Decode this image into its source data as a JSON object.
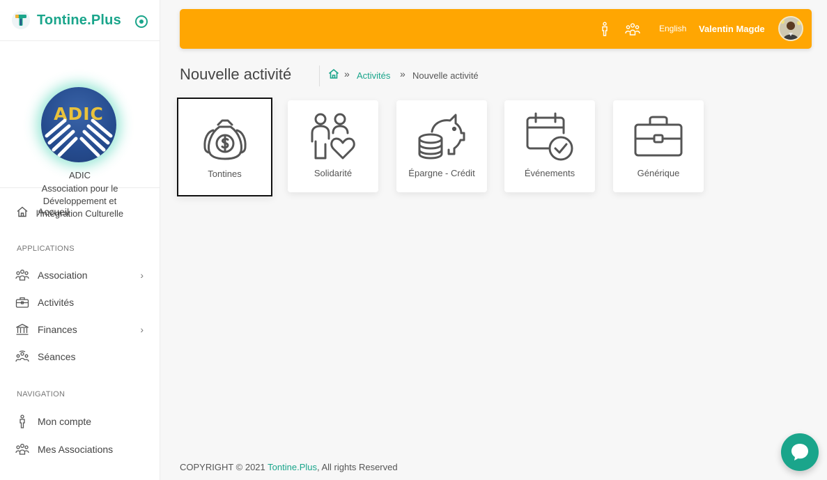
{
  "brand": {
    "name": "Tontine.Plus"
  },
  "organization": {
    "logo_text": "ADIC",
    "short_name": "ADIC",
    "full_name": "Association pour le Développement et l'Intégration Culturelle"
  },
  "sidebar": {
    "home": "Accueil",
    "section_applications": "APPLICATIONS",
    "applications": [
      {
        "label": "Association",
        "icon": "group-icon",
        "has_submenu": true
      },
      {
        "label": "Activités",
        "icon": "briefcase-icon",
        "has_submenu": false
      },
      {
        "label": "Finances",
        "icon": "bank-icon",
        "has_submenu": true
      },
      {
        "label": "Séances",
        "icon": "meeting-icon",
        "has_submenu": false
      }
    ],
    "section_navigation": "NAVIGATION",
    "navigation": [
      {
        "label": "Mon compte",
        "icon": "person-icon"
      },
      {
        "label": "Mes Associations",
        "icon": "group-icon"
      }
    ],
    "chevron": "›"
  },
  "header": {
    "language": "English",
    "user_name": "Valentin Magde",
    "background_color": "#ffa602"
  },
  "page": {
    "title": "Nouvelle activité",
    "breadcrumb": {
      "sep": "»",
      "link": "Activités",
      "current": "Nouvelle activité"
    }
  },
  "activity_types": [
    {
      "label": "Tontines",
      "icon": "money-bag-icon",
      "selected": true
    },
    {
      "label": "Solidarité",
      "icon": "people-heart-icon",
      "selected": false
    },
    {
      "label": "Épargne - Crédit",
      "icon": "piggy-bank-coins-icon",
      "selected": false
    },
    {
      "label": "Événements",
      "icon": "calendar-check-icon",
      "selected": false
    },
    {
      "label": "Générique",
      "icon": "toolbox-icon",
      "selected": false
    }
  ],
  "footer": {
    "prefix": "COPYRIGHT © 2021 ",
    "brand": "Tontine.Plus",
    "suffix": ", All rights Reserved"
  },
  "colors": {
    "accent": "#1aa58b",
    "header": "#ffa602"
  }
}
